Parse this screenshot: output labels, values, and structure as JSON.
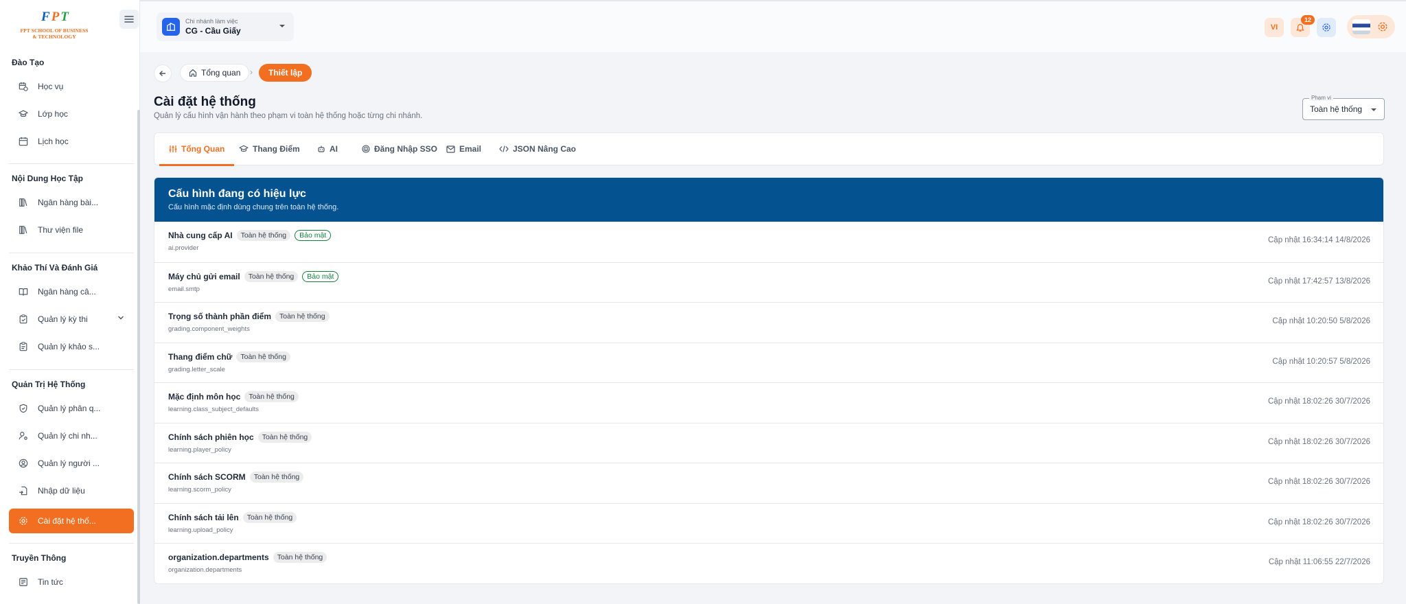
{
  "logo": {
    "text": "FPT",
    "line1": "FPT SCHOOL OF BUSINESS",
    "line2": "& TECHNOLOGY"
  },
  "branch": {
    "label": "Chi nhánh làm việc",
    "value": "CG - Cầu Giấy"
  },
  "header": {
    "lang": "VI",
    "notification_count": "12"
  },
  "sidebar": {
    "sections": [
      {
        "title": "Đào Tạo",
        "items": [
          {
            "label": "Học vụ",
            "icon": "calendar-clock-icon"
          },
          {
            "label": "Lớp học",
            "icon": "graduation-cap-icon"
          },
          {
            "label": "Lịch học",
            "icon": "calendar-icon"
          }
        ]
      },
      {
        "title": "Nội Dung Học Tập",
        "items": [
          {
            "label": "Ngân hàng bài...",
            "icon": "library-icon"
          },
          {
            "label": "Thư viện file",
            "icon": "library-icon"
          }
        ]
      },
      {
        "title": "Khảo Thí Và Đánh Giá",
        "items": [
          {
            "label": "Ngân hàng câ...",
            "icon": "book-open-icon"
          },
          {
            "label": "Quản lý kỳ thi",
            "icon": "clipboard-check-icon"
          },
          {
            "label": "Quản lý khảo s...",
            "icon": "clipboard-list-icon"
          }
        ]
      },
      {
        "title": "Quản Trị Hệ Thống",
        "items": [
          {
            "label": "Quản lý phân q...",
            "icon": "shield-icon"
          },
          {
            "label": "Quản lý chi nh...",
            "icon": "user-cog-icon"
          },
          {
            "label": "Quản lý người ...",
            "icon": "user-circle-icon"
          },
          {
            "label": "Nhập dữ liệu",
            "icon": "file-import-icon"
          },
          {
            "label": "Cài đặt hệ thố...",
            "icon": "gear-icon"
          }
        ]
      },
      {
        "title": "Truyền Thông",
        "items": [
          {
            "label": "Tin tức",
            "icon": "newspaper-icon"
          }
        ]
      }
    ]
  },
  "breadcrumb": {
    "home": "Tổng quan",
    "current": "Thiết lập"
  },
  "page": {
    "title": "Cài đặt hệ thống",
    "subtitle": "Quản lý cấu hình vận hành theo phạm vi toàn hệ thống hoặc từng chi nhánh."
  },
  "scope": {
    "label": "Phạm vi",
    "value": "Toàn hệ thống"
  },
  "tabs": [
    {
      "label": "Tổng Quan",
      "icon": "sliders-icon"
    },
    {
      "label": "Thang Điểm",
      "icon": "graduation-cap-icon"
    },
    {
      "label": "AI",
      "icon": "robot-icon"
    },
    {
      "label": "Đăng Nhập SSO",
      "icon": "fingerprint-icon"
    },
    {
      "label": "Email",
      "icon": "mail-icon"
    },
    {
      "label": "JSON Nâng Cao",
      "icon": "code-icon"
    }
  ],
  "config": {
    "title": "Cấu hình đang có hiệu lực",
    "subtitle": "Cấu hình mặc định dùng chung trên toàn hệ thống.",
    "rows": [
      {
        "name": "Nhà cung cấp AI",
        "scope": "Toàn hệ thống",
        "secure": "Bảo mật",
        "key": "ai.provider",
        "updated": "Cập nhật 16:34:14 14/8/2026"
      },
      {
        "name": "Máy chủ gửi email",
        "scope": "Toàn hệ thống",
        "secure": "Bảo mật",
        "key": "email.smtp",
        "updated": "Cập nhật 17:42:57 13/8/2026"
      },
      {
        "name": "Trọng số thành phần điểm",
        "scope": "Toàn hệ thống",
        "secure": "",
        "key": "grading.component_weights",
        "updated": "Cập nhật 10:20:50 5/8/2026"
      },
      {
        "name": "Thang điểm chữ",
        "scope": "Toàn hệ thống",
        "secure": "",
        "key": "grading.letter_scale",
        "updated": "Cập nhật 10:20:57 5/8/2026"
      },
      {
        "name": "Mặc định môn học",
        "scope": "Toàn hệ thống",
        "secure": "",
        "key": "learning.class_subject_defaults",
        "updated": "Cập nhật 18:02:26 30/7/2026"
      },
      {
        "name": "Chính sách phiên học",
        "scope": "Toàn hệ thống",
        "secure": "",
        "key": "learning.player_policy",
        "updated": "Cập nhật 18:02:26 30/7/2026"
      },
      {
        "name": "Chính sách SCORM",
        "scope": "Toàn hệ thống",
        "secure": "",
        "key": "learning.scorm_policy",
        "updated": "Cập nhật 18:02:26 30/7/2026"
      },
      {
        "name": "Chính sách tải lên",
        "scope": "Toàn hệ thống",
        "secure": "",
        "key": "learning.upload_policy",
        "updated": "Cập nhật 18:02:26 30/7/2026"
      },
      {
        "name": "organization.departments",
        "scope": "Toàn hệ thống",
        "secure": "",
        "key": "organization.departments",
        "updated": "Cập nhật 11:06:55 22/7/2026"
      }
    ]
  },
  "colors": {
    "accent": "#f26f21",
    "header_blue": "#04528f",
    "secure_green": "#15803d"
  }
}
